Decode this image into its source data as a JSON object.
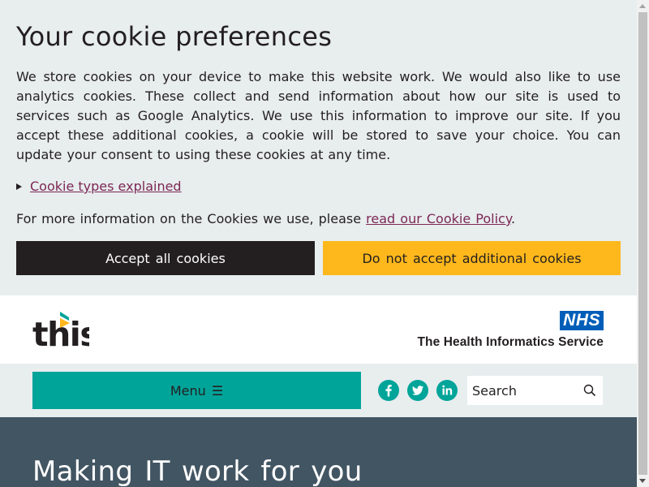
{
  "cookie_banner": {
    "title": "Your cookie preferences",
    "body": "We store cookies on your device to make this website work. We would also like to use analytics cookies. These collect and send information about how our site is used to services such as Google Analytics. We use this information to improve our site. If you accept these additional cookies, a cookie will be stored to save your choice. You can update your consent to using these cookies at any time.",
    "details_summary": "Cookie types explained",
    "more_info_prefix": "For more information on the Cookies we use, please ",
    "more_info_link": "read our Cookie Policy",
    "more_info_suffix": ".",
    "accept_label": "Accept all cookies",
    "reject_label": "Do not accept additional cookies"
  },
  "header": {
    "logo_text": "this",
    "nhs_logo": "NHS",
    "nhs_tagline": "The Health Informatics Service"
  },
  "nav": {
    "menu_label": "Menu",
    "menu_icon": "☰",
    "social": [
      {
        "name": "facebook",
        "icon": "f"
      },
      {
        "name": "twitter",
        "icon": "twitter-bird"
      },
      {
        "name": "linkedin",
        "icon": "in"
      }
    ],
    "search_placeholder": "Search"
  },
  "hero": {
    "title": "Making IT work for you"
  },
  "colors": {
    "banner_bg": "#e8edee",
    "accept_bg": "#231f20",
    "reject_bg": "#ffb81c",
    "teal": "#00a499",
    "nhs_blue": "#005eb8",
    "hero_bg": "#425563",
    "link": "#7c2855"
  }
}
